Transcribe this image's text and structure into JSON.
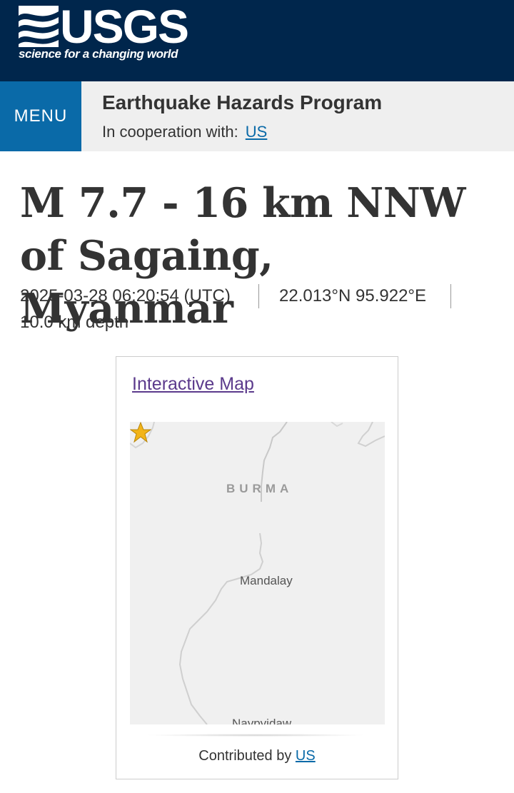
{
  "header": {
    "logo_text": "USGS",
    "tagline": "science for a changing world",
    "brand_color": "#00264c"
  },
  "program_bar": {
    "menu_label": "MENU",
    "title": "Earthquake Hazards Program",
    "cooperation_label": "In cooperation with:",
    "cooperation_link": "US",
    "menu_color": "#0a6aa8"
  },
  "event": {
    "title": "M 7.7 - 16 km NNW of Sagaing, Myanmar",
    "time": "2025-03-28 06:20:54 (UTC)",
    "location": "22.013°N 95.922°E",
    "depth": "10.0 km depth"
  },
  "map_card": {
    "link_label": "Interactive Map",
    "country_label": "BURMA",
    "city_label": "Mandalay",
    "city2_label": "Naypyidaw",
    "marker_icon": "star-icon",
    "contributed_label": "Contributed by",
    "contributed_link": "US"
  }
}
